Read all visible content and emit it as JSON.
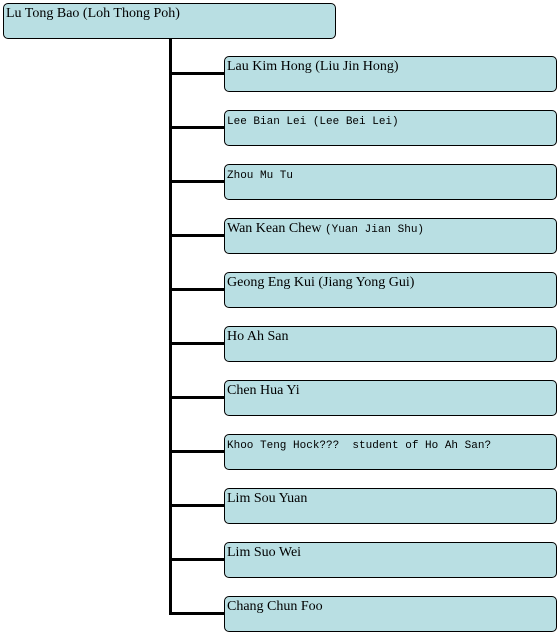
{
  "root": {
    "label": "Lu Tong Bao (Loh Thong Poh)"
  },
  "children": [
    {
      "label": "Lau Kim Hong (Liu Jin Hong)",
      "mono": false
    },
    {
      "label": "Lee Bian Lei (Lee Bei Lei)",
      "mono": true
    },
    {
      "label": "Zhou Mu Tu",
      "mono": true
    },
    {
      "label": "Wan Kean Chew ",
      "label_mono": "(Yuan Jian Shu)",
      "mono": false
    },
    {
      "label": "Geong Eng Kui (Jiang Yong Gui)",
      "mono": false
    },
    {
      "label": "Ho Ah San",
      "mono": false
    },
    {
      "label": "Chen Hua Yi",
      "mono": false
    },
    {
      "label": "Khoo Teng Hock???  student of Ho Ah San?",
      "mono": true
    },
    {
      "label": "Lim Sou Yuan",
      "mono": false
    },
    {
      "label": "Lim Suo Wei",
      "mono": false
    },
    {
      "label": "Chang Chun Foo",
      "mono": false
    }
  ],
  "colors": {
    "box_fill": "#b9dfe3",
    "line": "#000000"
  }
}
